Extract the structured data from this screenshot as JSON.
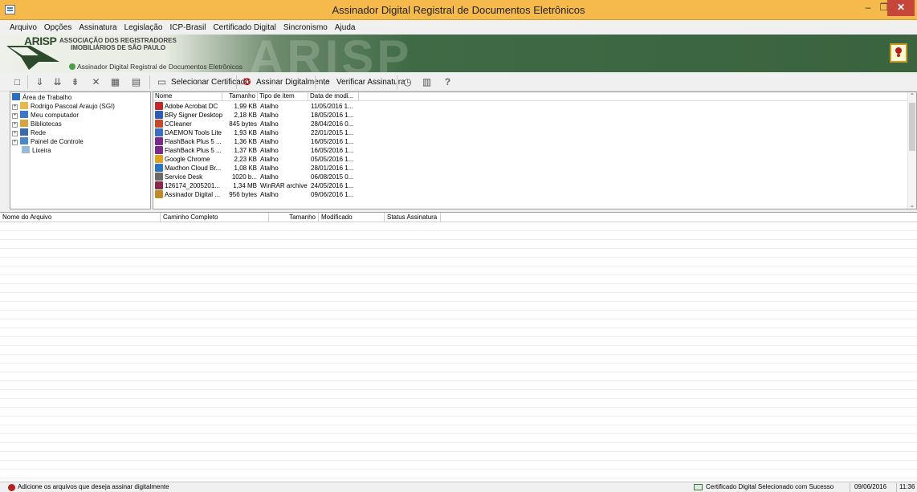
{
  "window": {
    "title": "Assinador Digital Registral de Documentos Eletrônicos",
    "minimize_glyph": "–",
    "restore_glyph": "❐",
    "close_glyph": "✕"
  },
  "menu": [
    "Arquivo",
    "Opções",
    "Assinatura",
    "Legislação",
    "ICP-Brasil",
    "Certificado Digital",
    "Sincronismo",
    "Ajuda"
  ],
  "banner": {
    "logo": "ARISP",
    "org_line1": "ASSOCIAÇÃO DOS REGISTRADORES",
    "org_line2": "IMOBILIÁRIOS DE SÃO PAULO",
    "subtitle": "Assinador Digital Registral de Documentos Eletrônicos",
    "background_word": "ARISP"
  },
  "toolbar": {
    "select_cert": "Selecionar Certificado",
    "sign": "Assinar Digitalmente",
    "verify": "Verificar Assinatura"
  },
  "tree": [
    {
      "label": "Área de Trabalho",
      "icon": "desktop-icon",
      "level": 0
    },
    {
      "label": "Rodrigo Pascoal Araujo (SGI)",
      "icon": "user-folder-icon",
      "level": 1
    },
    {
      "label": "Meu computador",
      "icon": "computer-icon",
      "level": 1
    },
    {
      "label": "Bibliotecas",
      "icon": "libraries-icon",
      "level": 1
    },
    {
      "label": "Rede",
      "icon": "network-icon",
      "level": 1
    },
    {
      "label": "Painel de Controle",
      "icon": "control-panel-icon",
      "level": 1
    },
    {
      "label": "Lixeira",
      "icon": "recycle-bin-icon",
      "level": 1
    }
  ],
  "file_list": {
    "columns": [
      "Nome",
      "Tamanho",
      "Tipo de item",
      "Data de modi..."
    ],
    "rows": [
      {
        "name": "Adobe Acrobat DC",
        "size": "1,99 KB",
        "type": "Atalho",
        "date": "11/05/2016 1...",
        "color": "#c0282a"
      },
      {
        "name": "BRy Signer Desktop",
        "size": "2,18 KB",
        "type": "Atalho",
        "date": "18/05/2016 1...",
        "color": "#2a5cb8"
      },
      {
        "name": "CCleaner",
        "size": "845 bytes",
        "type": "Atalho",
        "date": "28/04/2016 0...",
        "color": "#c8482a"
      },
      {
        "name": "DAEMON Tools Lite",
        "size": "1,93 KB",
        "type": "Atalho",
        "date": "22/01/2015 1...",
        "color": "#3a6ec4"
      },
      {
        "name": "FlashBack Plus 5 ...",
        "size": "1,36 KB",
        "type": "Atalho",
        "date": "16/05/2016 1...",
        "color": "#7a2a8a"
      },
      {
        "name": "FlashBack Plus 5 ...",
        "size": "1,37 KB",
        "type": "Atalho",
        "date": "16/05/2016 1...",
        "color": "#7a2a8a"
      },
      {
        "name": "Google Chrome",
        "size": "2,23 KB",
        "type": "Atalho",
        "date": "05/05/2016 1...",
        "color": "#e0a020"
      },
      {
        "name": "Maxthon Cloud Br...",
        "size": "1,08 KB",
        "type": "Atalho",
        "date": "28/01/2016 1...",
        "color": "#2a72c4"
      },
      {
        "name": "Service Desk",
        "size": "1020 b...",
        "type": "Atalho",
        "date": "06/08/2015 0...",
        "color": "#6a6a6a"
      },
      {
        "name": "126174_2005201...",
        "size": "1,34 MB",
        "type": "WinRAR archive",
        "date": "24/05/2016 1...",
        "color": "#8a2a4a"
      },
      {
        "name": "Assinador Digital ...",
        "size": "956 bytes",
        "type": "Atalho",
        "date": "09/06/2016 1...",
        "color": "#c08a2a"
      }
    ]
  },
  "grid": {
    "columns": [
      "Nome do Arquivo",
      "Caminho Completo",
      "Tamanho",
      "Modificado",
      "Status Assinatura"
    ]
  },
  "status": {
    "message": "Adicione os arquivos que deseja assinar digitalmente",
    "cert_status": "Certificado Digital Selecionado com Sucesso",
    "date": "09/06/2016",
    "time": "11:36"
  },
  "colors": {
    "titlebar": "#f5b94c",
    "close_button": "#c7463a",
    "banner_green": "#3f6a45"
  }
}
